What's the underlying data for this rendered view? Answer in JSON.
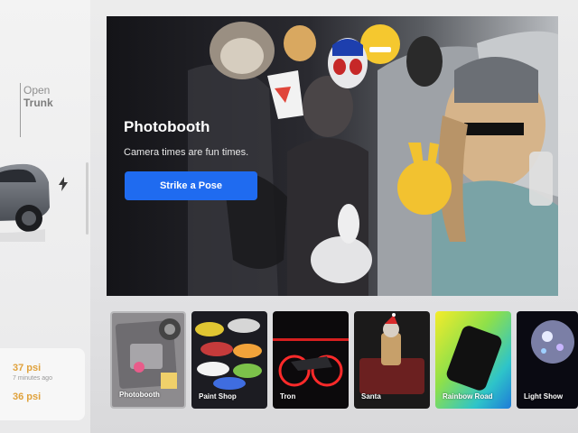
{
  "vehicle": {
    "open_label": "Open",
    "trunk_label": "Trunk",
    "tire_pressure": {
      "top_value": "37 psi",
      "top_time": "7 minutes ago",
      "bottom_value": "36 psi"
    }
  },
  "hero": {
    "title": "Photobooth",
    "subtitle": "Camera times are fun times.",
    "button_label": "Strike a Pose"
  },
  "carousel": {
    "items": [
      {
        "label": "Photobooth"
      },
      {
        "label": "Paint Shop"
      },
      {
        "label": "Tron"
      },
      {
        "label": "Santa"
      },
      {
        "label": "Rainbow Road"
      },
      {
        "label": "Light Show"
      }
    ]
  },
  "colors": {
    "accent": "#1f6bf0",
    "tire_pressure": "#e0a23c"
  }
}
